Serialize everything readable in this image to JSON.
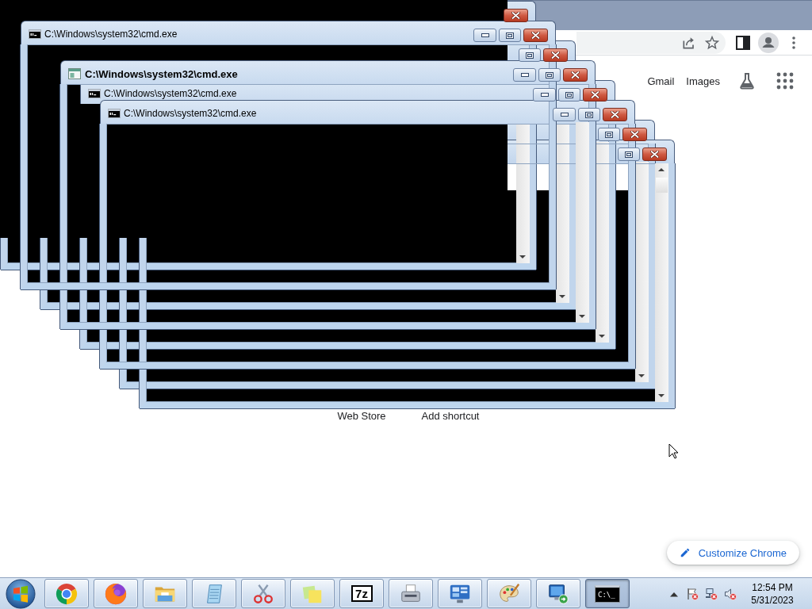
{
  "browser": {
    "header_links": [
      "Gmail",
      "Images"
    ],
    "shortcuts": [
      "Web Store",
      "Add shortcut"
    ],
    "customize_button": "Customize Chrome"
  },
  "windows": [
    {
      "title_covered": true
    },
    {
      "title": "C:\\Windows\\system32\\cmd.exe",
      "kind": "regular",
      "title_covered": false
    },
    {
      "title_covered": true
    },
    {
      "title": "C:\\Windows\\system32\\cmd.exe",
      "kind": "bold",
      "title_covered": false
    },
    {
      "title": "C:\\Windows\\system32\\cmd.exe",
      "kind": "regular",
      "title_covered": false
    },
    {
      "title": "C:\\Windows\\system32\\cmd.exe",
      "kind": "regular",
      "title_covered": false
    },
    {
      "title_covered": true
    },
    {
      "title_covered": true
    }
  ],
  "taskbar": {
    "items": [
      {
        "kind": "ring",
        "selected": false
      },
      {
        "kind": "globe",
        "selected": false
      },
      {
        "kind": "folder",
        "selected": false
      },
      {
        "kind": "notepad",
        "selected": false
      },
      {
        "kind": "scissors",
        "selected": false
      },
      {
        "kind": "notes",
        "selected": false
      },
      {
        "kind": "archive",
        "label": "7z",
        "selected": false
      },
      {
        "kind": "fax",
        "selected": false
      },
      {
        "kind": "panel",
        "selected": false
      },
      {
        "kind": "palette",
        "selected": false
      },
      {
        "kind": "remote",
        "selected": false
      },
      {
        "kind": "console",
        "label": "C:\\_",
        "selected": true
      }
    ],
    "tray": {
      "action_center": {
        "alert": true
      },
      "network": {
        "connected": false
      },
      "volume": {
        "muted": true
      }
    },
    "clock": {
      "time": "12:54 PM",
      "date": "5/31/2023"
    }
  }
}
